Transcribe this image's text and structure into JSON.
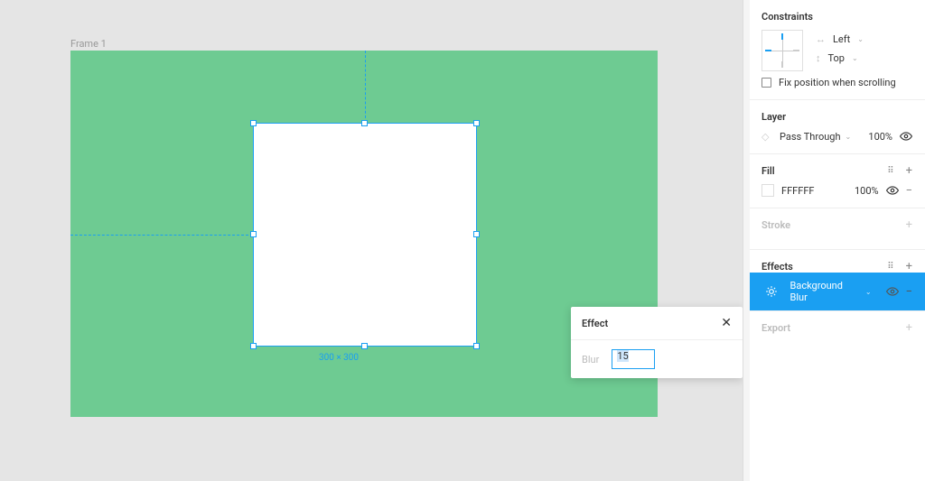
{
  "frame": {
    "label": "Frame 1",
    "dimensions": "300 × 300",
    "bg": "#6ecb92"
  },
  "popup": {
    "title": "Effect",
    "blur_label": "Blur",
    "blur_value": "15"
  },
  "inspector": {
    "constraints": {
      "title": "Constraints",
      "horizontal": "Left",
      "vertical": "Top",
      "fix_label": "Fix position when scrolling"
    },
    "layer": {
      "title": "Layer",
      "blend": "Pass Through",
      "opacity": "100%"
    },
    "fill": {
      "title": "Fill",
      "hex": "FFFFFF",
      "opacity": "100%"
    },
    "stroke": {
      "title": "Stroke"
    },
    "effects": {
      "title": "Effects",
      "item": "Background Blur"
    },
    "export": {
      "title": "Export"
    }
  }
}
